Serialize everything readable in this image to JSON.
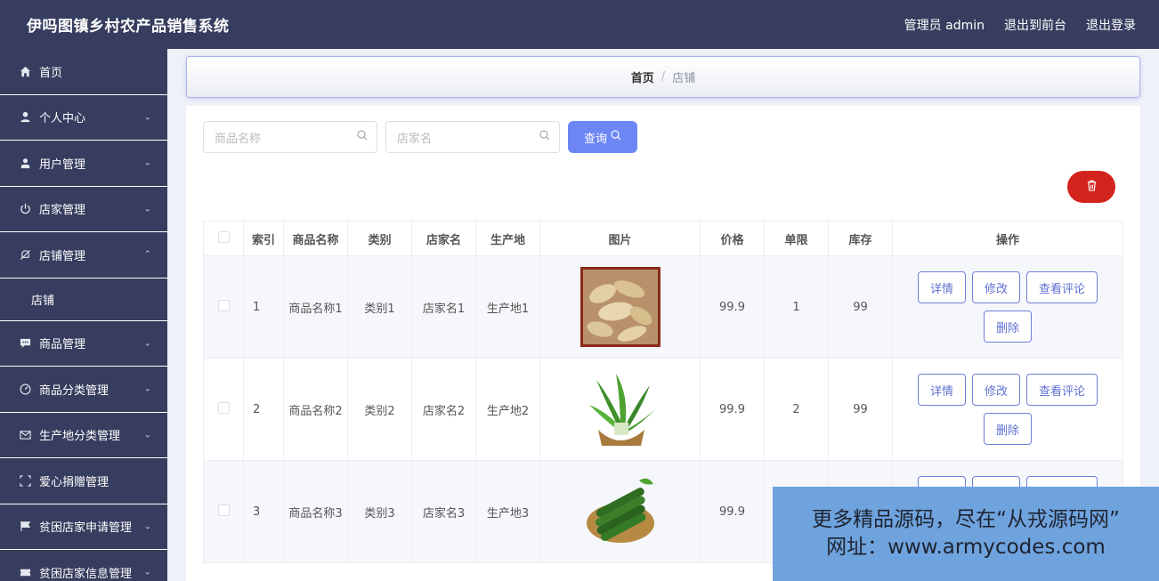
{
  "header": {
    "title": "伊吗图镇乡村农产品销售系统",
    "admin": "管理员 admin",
    "to_front": "退出到前台",
    "logout": "退出登录"
  },
  "sidebar": {
    "items": [
      {
        "label": "首页",
        "icon": "home-icon"
      },
      {
        "label": "个人中心",
        "icon": "user-icon"
      },
      {
        "label": "用户管理",
        "icon": "user-manage-icon"
      },
      {
        "label": "店家管理",
        "icon": "power-icon"
      },
      {
        "label": "店铺管理",
        "icon": "bell-off-icon"
      },
      {
        "label": "店铺"
      },
      {
        "label": "商品管理",
        "icon": "chat-icon"
      },
      {
        "label": "商品分类管理",
        "icon": "gauge-icon"
      },
      {
        "label": "生产地分类管理",
        "icon": "mail-icon"
      },
      {
        "label": "爱心捐赠管理",
        "icon": "frame-icon"
      },
      {
        "label": "贫困店家申请管理",
        "icon": "flag-icon"
      },
      {
        "label": "贫困店家信息管理",
        "icon": "ticket-icon"
      }
    ]
  },
  "breadcrumb": {
    "home": "首页",
    "current": "店铺"
  },
  "search": {
    "product_placeholder": "商品名称",
    "shop_placeholder": "店家名",
    "query_label": "查询"
  },
  "table": {
    "headers": [
      "索引",
      "商品名称",
      "类别",
      "店家名",
      "生产地",
      "图片",
      "价格",
      "单限",
      "库存",
      "操作"
    ],
    "rows": [
      {
        "index": "1",
        "name": "商品名称1",
        "category": "类别1",
        "shop": "店家名1",
        "origin": "生产地1",
        "image": "ginger",
        "price": "99.9",
        "limit": "1",
        "stock": "99"
      },
      {
        "index": "2",
        "name": "商品名称2",
        "category": "类别2",
        "shop": "店家名2",
        "origin": "生产地2",
        "image": "greens",
        "price": "99.9",
        "limit": "2",
        "stock": "99"
      },
      {
        "index": "3",
        "name": "商品名称3",
        "category": "类别3",
        "shop": "店家名3",
        "origin": "生产地3",
        "image": "cucumber",
        "price": "99.9",
        "limit": "",
        "stock": ""
      }
    ],
    "actions": {
      "detail": "详情",
      "edit": "修改",
      "reviews": "查看评论",
      "delete": "删除"
    }
  },
  "watermark": {
    "line1": "更多精品源码，尽在“从戎源码网”",
    "line2": "网址：www.armycodes.com"
  }
}
